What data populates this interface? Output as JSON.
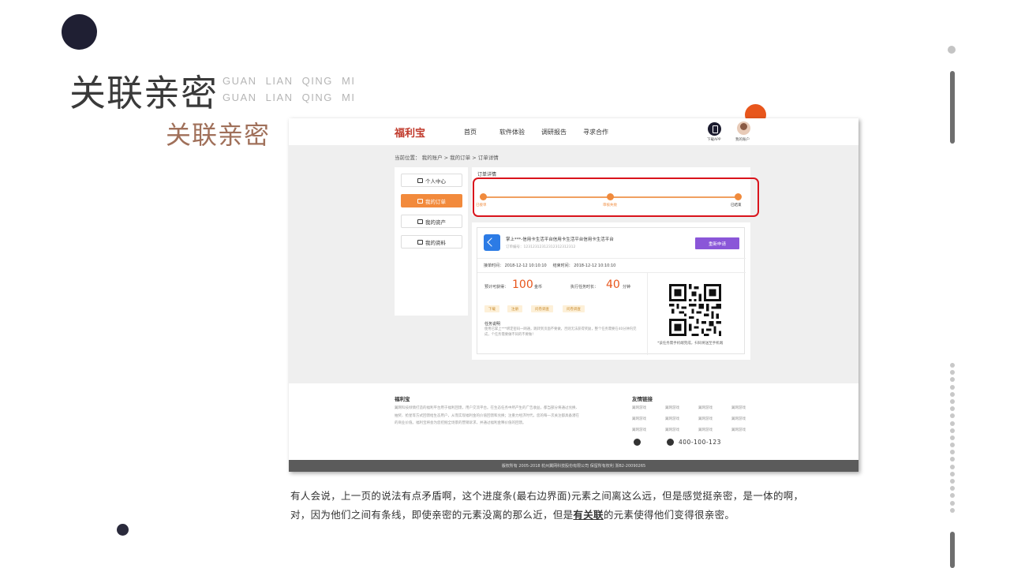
{
  "slide": {
    "title": "关联亲密",
    "pinyin_line1": "GUAN LIAN QING MI",
    "pinyin_line2": "GUAN LIAN QING MI",
    "subtitle": "关联亲密",
    "caption_line1": "有人会说，上一页的说法有点矛盾啊，这个进度条(最右边界面)元素之间离这么远，但是感觉挺亲密，是一体的啊，",
    "caption_line2_before": "对，因为他们之间有条线，即使亲密的元素没离的那么近，但是",
    "caption_line2_emph": "有关联",
    "caption_line2_after": "的元素使得他们变得很亲密。",
    "colors": {
      "accent": "#e8561c",
      "highlight_box": "#d9141c",
      "title": "#3a3a3a",
      "subtitle": "#a0705a"
    }
  },
  "screenshot": {
    "header": {
      "logo": "福利宝",
      "nav": [
        "首页",
        "软件体验",
        "调研报告",
        "寻求合作"
      ],
      "download_label": "下载APP",
      "account_label": "我的账户",
      "icons": [
        "phone-icon",
        "avatar"
      ]
    },
    "breadcrumb": "当前位置： 我的账户 > 我的订单 > 订单详情",
    "sidebar": {
      "items": [
        {
          "label": "个人中心",
          "icon": "home-icon"
        },
        {
          "label": "我的订单",
          "icon": "order-icon",
          "active": true
        },
        {
          "label": "我的资产",
          "icon": "asset-icon"
        },
        {
          "label": "我的资料",
          "icon": "profile-icon"
        }
      ]
    },
    "progress": {
      "title": "订单详情",
      "steps": [
        "已接单",
        "审核失败",
        "已结束"
      ]
    },
    "order": {
      "title": "掌上***-信用卡生活平台信用卡生活平台信用卡生活平台",
      "order_no": "订单编号：12312312312312312312312",
      "apply_button": "重新申请",
      "accept_time": "接单时间： 2018-12-12  10:10:10",
      "end_time": "结束时间： 2018-12-12  10:10:10",
      "earn_label": "预计可获得：",
      "earn_value": "100",
      "earn_unit": "金币",
      "duration_label": "执行任务时长：",
      "duration_value": "40",
      "duration_unit": "分钟",
      "tags": [
        "下载",
        "注册",
        "问卷调查",
        "问卷调查"
      ],
      "task_title": "任务说明",
      "task_desc": "使用已掌上***绑定密码一网通，跳转到页面不要做，否则无法获得奖励，整个任务需要在40分钟内完成，个任务需要做不同的不要做！",
      "qr_note": "*该任务需手机端完成，扫码将送至手机端"
    },
    "footer": {
      "brand_title": "福利宝",
      "brand_text": "翼网科技倾情打造的福利平台用于福利回馈，用户交流平台。在生态任务中所产生的广告收益，都当部分将通过兑换、抽奖、抢星等方式回馈给生态用户，从而实现福利金的价值回馈和兑换；注重力经济时代，您的每一次关注都具备潜在的商业价值。福利宝将会为您挖掘全场景的营销诉求，并通过福利金释价值的回馈。",
      "links_title": "友情链接",
      "links": [
        "翼网游戏",
        "翼网游戏",
        "翼网游戏",
        "翼网游戏",
        "翼网游戏",
        "翼网游戏",
        "翼网游戏",
        "翼网游戏",
        "翼网游戏",
        "翼网游戏",
        "翼网游戏",
        "翼网游戏"
      ],
      "phone": "400-100-123",
      "copyright": "版权所有 2005-2018 杭州翼网科技股份有限公司 保留所有权利 浙B2-20090265"
    }
  }
}
